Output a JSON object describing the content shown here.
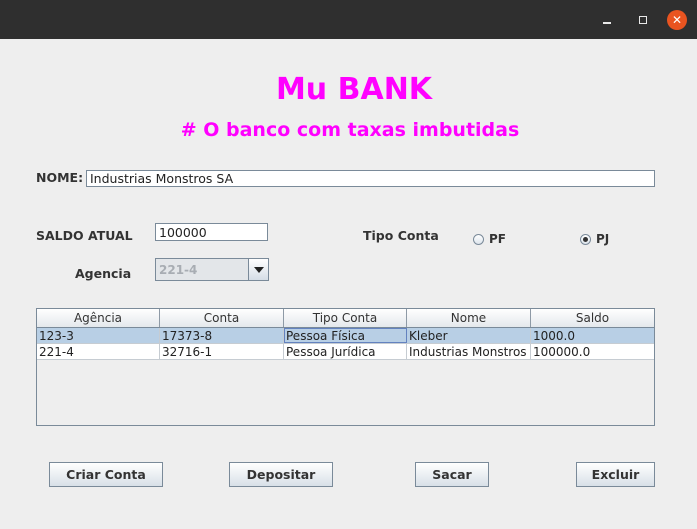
{
  "window": {
    "close_glyph": "✕"
  },
  "header": {
    "title": "Mu BANK",
    "subtitle": "# O banco com taxas imbutidas"
  },
  "form": {
    "nome_label": "NOME:",
    "nome_value": "Industrias Monstros SA",
    "saldo_label": "SALDO ATUAL",
    "saldo_value": "100000",
    "tipo_label": "Tipo Conta",
    "radio_pf": "PF",
    "radio_pj": "PJ",
    "selected_tipo": "PJ",
    "agencia_label": "Agencia",
    "agencia_value": "221-4"
  },
  "table": {
    "columns": [
      "Agência",
      "Conta",
      "Tipo Conta",
      "Nome",
      "Saldo"
    ],
    "rows": [
      [
        "123-3",
        "17373-8",
        "Pessoa Física",
        "Kleber",
        "1000.0"
      ],
      [
        "221-4",
        "32716-1",
        "Pessoa Jurídica",
        "Industrias Monstros SA",
        "100000.0"
      ]
    ],
    "selected_row": 0
  },
  "buttons": {
    "criar": "Criar Conta",
    "depositar": "Depositar",
    "sacar": "Sacar",
    "excluir": "Excluir"
  },
  "colors": {
    "title": "#ff00ff",
    "titlebar": "#2f2f2f",
    "close": "#e95420",
    "selection": "#b8cfe5"
  }
}
